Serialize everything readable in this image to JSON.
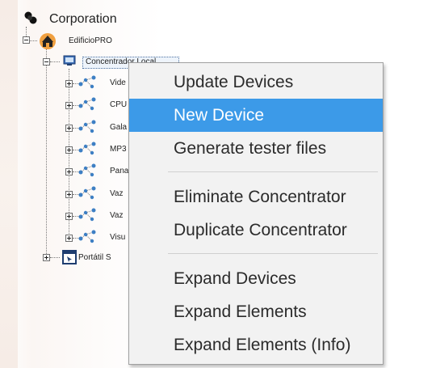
{
  "tree": {
    "root": {
      "label": "Corporation",
      "icon": "root-node-icon"
    },
    "edificio": {
      "label": "EdificioPRO",
      "icon": "building-icon"
    },
    "concentrador": {
      "label": "Concentrador Local",
      "icon": "monitor-icon"
    },
    "devices": [
      {
        "label": "Vide",
        "icon": "device-network-icon"
      },
      {
        "label": "CPU",
        "icon": "device-network-icon"
      },
      {
        "label": "Gala",
        "icon": "device-network-icon"
      },
      {
        "label": "MP3",
        "icon": "device-network-icon"
      },
      {
        "label": "Pana",
        "icon": "device-network-icon"
      },
      {
        "label": "Vaz",
        "icon": "device-network-icon"
      },
      {
        "label": "Vaz",
        "icon": "device-network-icon"
      },
      {
        "label": "Visu",
        "icon": "device-network-icon"
      }
    ],
    "portatil": {
      "label": "Portátil S",
      "icon": "window-icon"
    }
  },
  "context_menu": {
    "items": [
      {
        "label": "Update Devices",
        "highlighted": false
      },
      {
        "label": "New Device",
        "highlighted": true
      },
      {
        "label": "Generate tester files",
        "highlighted": false
      },
      {
        "label": "Eliminate Concentrator",
        "highlighted": false
      },
      {
        "label": "Duplicate Concentrator",
        "highlighted": false
      },
      {
        "label": "Expand Devices",
        "highlighted": false
      },
      {
        "label": "Expand Elements",
        "highlighted": false
      },
      {
        "label": "Expand Elements (Info)",
        "highlighted": false
      }
    ]
  },
  "colors": {
    "menu_highlight": "#3c9ae8",
    "menu_background": "#f2f2f2",
    "building_orange": "#f0a040",
    "device_blue": "#3d7fc4"
  }
}
